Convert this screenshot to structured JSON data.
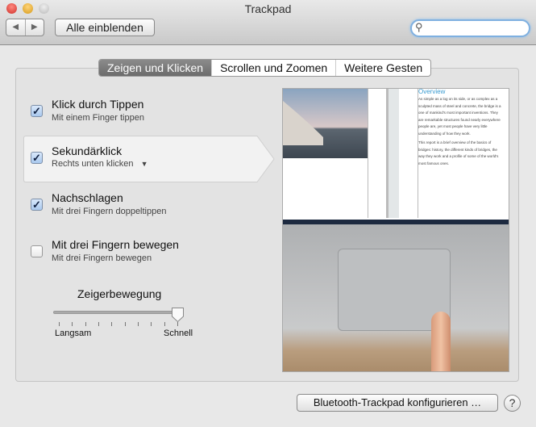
{
  "window": {
    "title": "Trackpad"
  },
  "toolbar": {
    "back_icon": "◀",
    "forward_icon": "▶",
    "show_all_label": "Alle einblenden",
    "search_placeholder": ""
  },
  "tabs": [
    {
      "label": "Zeigen und Klicken",
      "active": true
    },
    {
      "label": "Scrollen und Zoomen",
      "active": false
    },
    {
      "label": "Weitere Gesten",
      "active": false
    }
  ],
  "options": [
    {
      "label": "Klick durch Tippen",
      "sub": "Mit einem Finger tippen",
      "checked": true
    },
    {
      "label": "Sekundärklick",
      "sub": "Rechts unten klicken",
      "checked": true
    },
    {
      "label": "Nachschlagen",
      "sub": "Mit drei Fingern doppeltippen",
      "checked": true
    },
    {
      "label": "Mit drei Fingern bewegen",
      "sub": "Mit drei Fingern bewegen",
      "checked": false
    }
  ],
  "slider": {
    "title": "Zeigerbewegung",
    "min_label": "Langsam",
    "max_label": "Schnell",
    "value_fraction": 1.0,
    "ticks": 10
  },
  "preview": {
    "heading": "Overview",
    "para1": "As simple as a log on its side, or as complex as a sculpted mass of steel and concrete, the bridge is a one of mankind's most important inventions. They are remarkable structures found nearly everywhere people are, yet most people have very little understanding of how they work.",
    "para2": "This report is a brief overview of the basics of bridges: history, the different kinds of bridges, the way they work and a profile of some of the world's most famous ones."
  },
  "footer": {
    "bluetooth_label": "Bluetooth-Trackpad konfigurieren …",
    "help_label": "?"
  },
  "colors": {
    "accent": "#7fb0e0",
    "close": "#e0443e",
    "minimize": "#dea123",
    "zoom": "#c8c8c8"
  }
}
